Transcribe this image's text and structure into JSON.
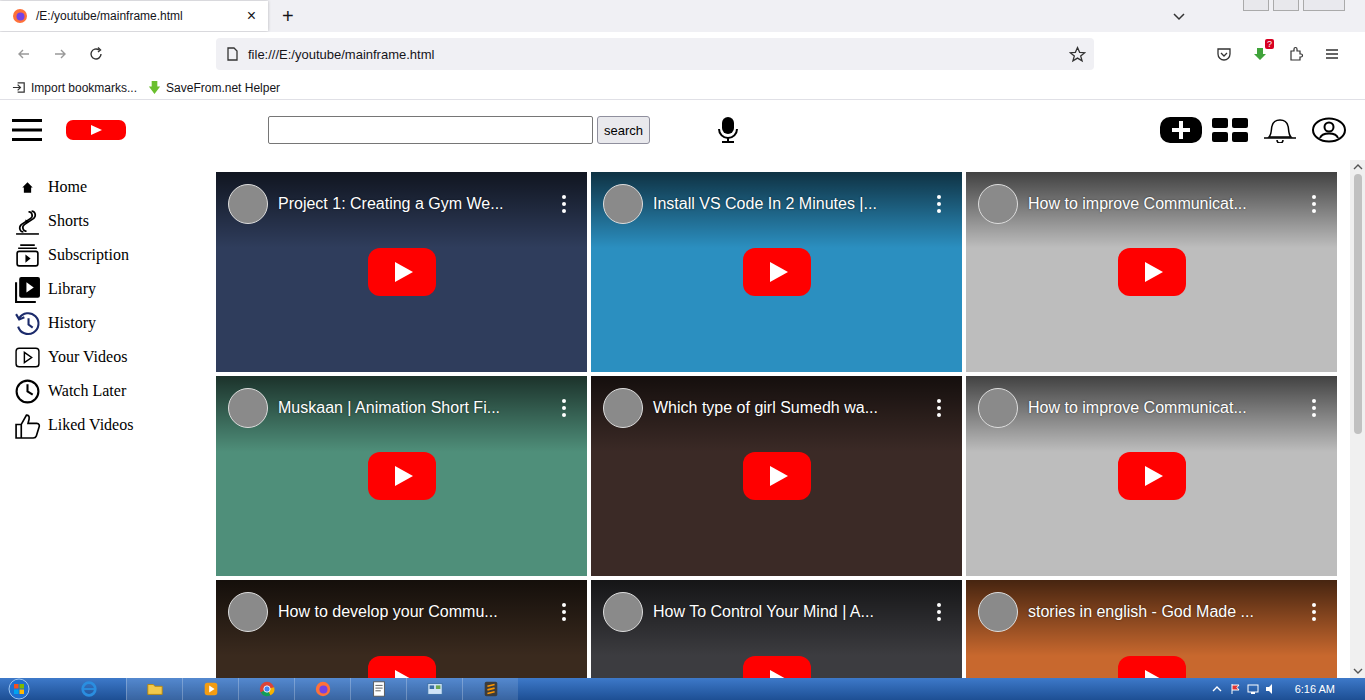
{
  "browser": {
    "tab": {
      "title": "/E:/youtube/mainframe.html",
      "close": "×",
      "selected": true
    },
    "new_tab": "+",
    "url": "file:///E:/youtube/mainframe.html",
    "download_badge": "?",
    "bookmarks": [
      {
        "label": "Import bookmarks..."
      },
      {
        "label": "SaveFrom.net Helper"
      }
    ]
  },
  "page": {
    "search": {
      "value": "",
      "button": "search"
    },
    "sidebar": {
      "items": [
        {
          "label": "Home"
        },
        {
          "label": "Shorts"
        },
        {
          "label": "Subscription"
        },
        {
          "label": "Library"
        },
        {
          "label": "History"
        },
        {
          "label": "Your Videos"
        },
        {
          "label": "Watch Later"
        },
        {
          "label": "Liked Videos"
        }
      ]
    },
    "videos": [
      {
        "title": "Project 1: Creating a Gym We...",
        "color": "#2f3d5c"
      },
      {
        "title": "Install VS Code In 2 Minutes |...",
        "color": "#2b8fc0"
      },
      {
        "title": "How to improve Communicat...",
        "color": "#bdbdbd"
      },
      {
        "title": "Muskaan | Animation Short Fi...",
        "color": "#4f8f7a"
      },
      {
        "title": "Which type of girl Sumedh wa...",
        "color": "#3b2a26"
      },
      {
        "title": "How to improve Communicat...",
        "color": "#bdbdbd"
      },
      {
        "title": "How to develop your Commu...",
        "color": "#3a2a1e"
      },
      {
        "title": "How To Control Your Mind | A...",
        "color": "#3c3c40"
      },
      {
        "title": "stories in english - God Made ...",
        "color": "#c8682e"
      }
    ]
  },
  "taskbar": {
    "time": "6:16 AM"
  }
}
